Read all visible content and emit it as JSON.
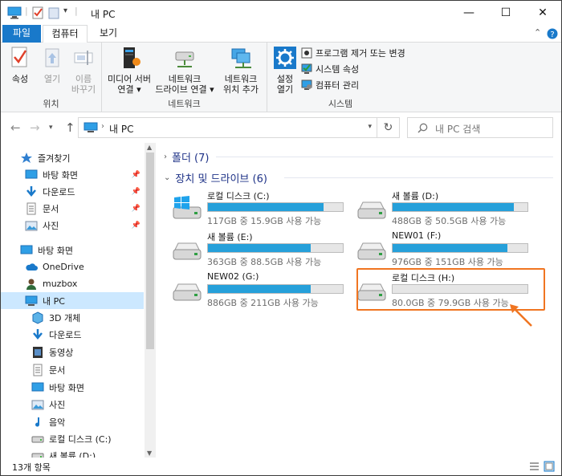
{
  "window": {
    "title": "내 PC",
    "minimize": "—",
    "maximize": "☐",
    "close": "✕"
  },
  "ribbon_tabs": {
    "file": "파일",
    "computer": "컴퓨터",
    "view": "보기"
  },
  "ribbon": {
    "location": {
      "label": "위치",
      "properties": "속성",
      "open": "열기",
      "rename_1": "이름",
      "rename_2": "바꾸기"
    },
    "network": {
      "label": "네트워크",
      "media_1": "미디어 서버",
      "media_2": "연결 ▾",
      "mapdrive_1": "네트워크",
      "mapdrive_2": "드라이브 연결 ▾",
      "addloc_1": "네트워크",
      "addloc_2": "위치 추가"
    },
    "system": {
      "label": "시스템",
      "settings_1": "설정",
      "settings_2": "열기",
      "uninstall": "프로그램 제거 또는 변경",
      "sysprops": "시스템 속성",
      "manage": "컴퓨터 관리"
    }
  },
  "address": {
    "path": "내 PC",
    "search_placeholder": "내 PC 검색"
  },
  "nav": {
    "items": [
      {
        "label": "즐겨찾기",
        "icon": "star-icon",
        "level": 0
      },
      {
        "label": "바탕 화면",
        "icon": "desktop-icon",
        "level": 1,
        "pinned": true
      },
      {
        "label": "다운로드",
        "icon": "download-icon",
        "level": 1,
        "pinned": true
      },
      {
        "label": "문서",
        "icon": "document-icon",
        "level": 1,
        "pinned": true
      },
      {
        "label": "사진",
        "icon": "pictures-icon",
        "level": 1,
        "pinned": true
      },
      {
        "label": "바탕 화면",
        "icon": "desktop-icon",
        "level": 0
      },
      {
        "label": "OneDrive",
        "icon": "cloud-icon",
        "level": 1
      },
      {
        "label": "muzbox",
        "icon": "user-icon",
        "level": 1
      },
      {
        "label": "내 PC",
        "icon": "pc-icon",
        "level": 1,
        "selected": true
      },
      {
        "label": "3D 개체",
        "icon": "3d-objects-icon",
        "level": 2
      },
      {
        "label": "다운로드",
        "icon": "download-icon",
        "level": 2
      },
      {
        "label": "동영상",
        "icon": "video-icon",
        "level": 2
      },
      {
        "label": "문서",
        "icon": "document-icon",
        "level": 2
      },
      {
        "label": "바탕 화면",
        "icon": "desktop-icon",
        "level": 2
      },
      {
        "label": "사진",
        "icon": "pictures-icon",
        "level": 2
      },
      {
        "label": "음악",
        "icon": "music-icon",
        "level": 2
      },
      {
        "label": "로컬 디스크 (C:)",
        "icon": "drive-icon",
        "level": 2
      },
      {
        "label": "새 볼륨 (D:)",
        "icon": "drive-icon",
        "level": 2
      }
    ]
  },
  "content": {
    "folders_header": "폴더 (7)",
    "drives_header": "장치 및 드라이브 (6)",
    "drives": [
      {
        "name": "로컬 디스크 (C:)",
        "caption": "117GB 중 15.9GB 사용 가능",
        "used_fraction": 0.86,
        "icon": "windows-drive-icon"
      },
      {
        "name": "새 볼륨 (D:)",
        "caption": "488GB 중 50.5GB 사용 가능",
        "used_fraction": 0.9,
        "icon": "drive-icon"
      },
      {
        "name": "새 볼륨 (E:)",
        "caption": "363GB 중 88.5GB 사용 가능",
        "used_fraction": 0.76,
        "icon": "drive-icon"
      },
      {
        "name": "NEW01 (F:)",
        "caption": "976GB 중 151GB 사용 가능",
        "used_fraction": 0.85,
        "icon": "drive-icon"
      },
      {
        "name": "NEW02 (G:)",
        "caption": "886GB 중 211GB 사용 가능",
        "used_fraction": 0.76,
        "icon": "drive-icon"
      },
      {
        "name": "로컬 디스크 (H:)",
        "caption": "80.0GB 중 79.9GB 사용 가능",
        "used_fraction": 0.0,
        "icon": "drive-icon"
      }
    ]
  },
  "status": {
    "count": "13개 항목"
  },
  "colors": {
    "accent": "#1979ca",
    "bar_fill": "#26a0da",
    "highlight": "#f07521",
    "selection": "#cce8ff"
  }
}
